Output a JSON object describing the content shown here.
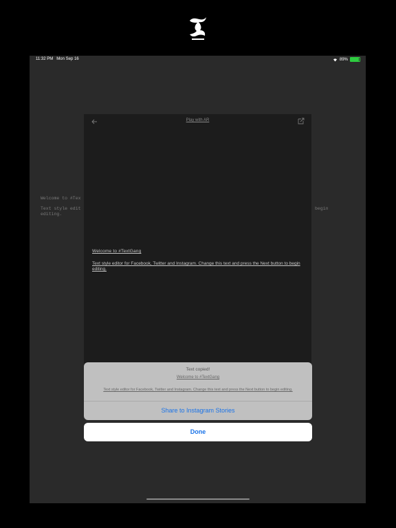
{
  "logo_name": "textgang-logo-icon",
  "status": {
    "time": "11:32 PM",
    "date": "Mon Sep 16",
    "battery": "89%",
    "battery_level": 0.89
  },
  "background": {
    "welcome": "Welcome to #Tex",
    "body_line1": "Text style edit",
    "body_line2": "editing.",
    "body_right": "begin"
  },
  "editor": {
    "title": "Play with AR",
    "styled_heading": "Welcome to #TextGang",
    "styled_body": "Text style editor for Facebook, Twitter and Instagram. Change this text and press the Next button to begin editing."
  },
  "sheet": {
    "title": "Text copied!",
    "heading": "Welcome to #TextGang",
    "body": "Text style editor for Facebook, Twitter and Instagram. Change this text and press the Next button to begin editing.",
    "share": "Share to Instagram Stories"
  },
  "done": "Done",
  "colors": {
    "accent": "#1a73e8",
    "battery": "#2ecc40"
  }
}
